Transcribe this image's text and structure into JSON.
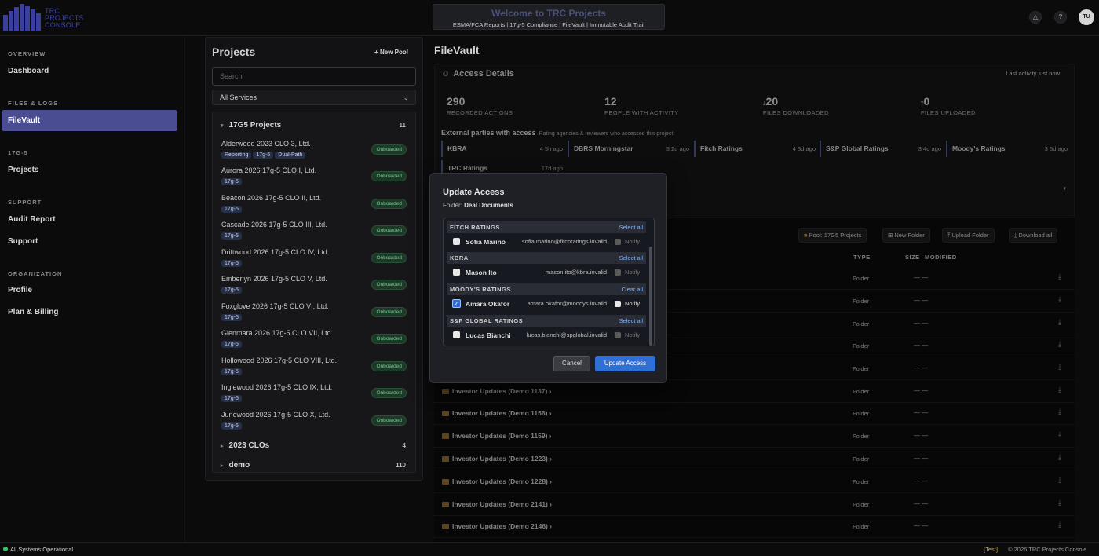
{
  "brand": {
    "line1": "TRC",
    "line2": "PROJECTS",
    "line3": "CONSOLE"
  },
  "header": {
    "welcome": "Welcome to TRC Projects",
    "subtitle": "ESMA/FCA Reports | 17g-5 Compliance | FileVault | Immutable Audit Trail",
    "avatar": "TU"
  },
  "sidebar": {
    "overview": "OVERVIEW",
    "dashboard": "Dashboard",
    "files_logs": "FILES & LOGS",
    "filevault": "FileVault",
    "section_17g5": "17G-5",
    "projects": "Projects",
    "support_sec": "SUPPORT",
    "audit": "Audit Report",
    "support": "Support",
    "org": "ORGANIZATION",
    "profile": "Profile",
    "billing": "Plan & Billing"
  },
  "projects": {
    "title": "Projects",
    "new_pool": "+ New Pool",
    "search_placeholder": "Search",
    "filter": "All Services",
    "groups": [
      {
        "name": "17G5 Projects",
        "count": "11"
      },
      {
        "name": "2023 CLOs",
        "count": "4"
      },
      {
        "name": "demo",
        "count": "110"
      }
    ],
    "items": [
      {
        "name": "Alderwood 2023 CLO 3, Ltd.",
        "tags": [
          "Reporting",
          "17g-5",
          "Dual-Path"
        ],
        "status": "Onboarded"
      },
      {
        "name": "Aurora 2026 17g-5 CLO I, Ltd.",
        "tags": [
          "17g-5"
        ],
        "status": "Onboarded"
      },
      {
        "name": "Beacon 2026 17g-5 CLO II, Ltd.",
        "tags": [
          "17g-5"
        ],
        "status": "Onboarded"
      },
      {
        "name": "Cascade 2026 17g-5 CLO III, Ltd.",
        "tags": [
          "17g-5"
        ],
        "status": "Onboarded"
      },
      {
        "name": "Driftwood 2026 17g-5 CLO IV, Ltd.",
        "tags": [
          "17g-5"
        ],
        "status": "Onboarded"
      },
      {
        "name": "Emberlyn 2026 17g-5 CLO V, Ltd.",
        "tags": [
          "17g-5"
        ],
        "status": "Onboarded"
      },
      {
        "name": "Foxglove 2026 17g-5 CLO VI, Ltd.",
        "tags": [
          "17g-5"
        ],
        "status": "Onboarded"
      },
      {
        "name": "Glenmara 2026 17g-5 CLO VII, Ltd.",
        "tags": [
          "17g-5"
        ],
        "status": "Onboarded"
      },
      {
        "name": "Hollowood 2026 17g-5 CLO VIII, Ltd.",
        "tags": [
          "17g-5"
        ],
        "status": "Onboarded"
      },
      {
        "name": "Inglewood 2026 17g-5 CLO IX, Ltd.",
        "tags": [
          "17g-5"
        ],
        "status": "Onboarded"
      },
      {
        "name": "Junewood 2026 17g-5 CLO X, Ltd.",
        "tags": [
          "17g-5"
        ],
        "status": "Onboarded"
      }
    ]
  },
  "filevault": {
    "title": "FileVault",
    "access_title": "Access Details",
    "last_activity": "Last activity just now",
    "stats": [
      {
        "value": "290",
        "label": "RECORDED ACTIONS"
      },
      {
        "value": "12",
        "label": "PEOPLE WITH ACTIVITY"
      },
      {
        "value": "20",
        "label": "FILES DOWNLOADED"
      },
      {
        "value": "0",
        "label": "FILES UPLOADED"
      }
    ],
    "ext_title": "External parties with access",
    "ext_sub": "Rating agencies & reviewers who accessed this project",
    "parties": [
      {
        "name": "KBRA",
        "meta": "4  5h ago"
      },
      {
        "name": "DBRS Morningstar",
        "meta": "3  2d ago"
      },
      {
        "name": "Fitch Ratings",
        "meta": "4  3d ago"
      },
      {
        "name": "S&P Global Ratings",
        "meta": "3  4d ago"
      },
      {
        "name": "Moody's Ratings",
        "meta": "3  5d ago"
      },
      {
        "name": "TRC Ratings",
        "meta": "17d ago"
      }
    ],
    "toolbar": {
      "pool": "Pool: 17G5 Projects",
      "new_folder": "New Folder",
      "upload": "Upload Folder",
      "download": "Download all"
    },
    "columns": {
      "type": "TYPE",
      "size": "SIZE",
      "modified": "MODIFIED"
    },
    "rows": [
      {
        "name": "",
        "type": "Folder",
        "size": "— —"
      },
      {
        "name": "",
        "type": "Folder",
        "size": "— —"
      },
      {
        "name": "",
        "type": "Folder",
        "size": "— —"
      },
      {
        "name": "",
        "type": "Folder",
        "size": "— —"
      },
      {
        "name": "",
        "type": "Folder",
        "size": "— —"
      },
      {
        "name": "Investor Updates (Demo 1137)",
        "type": "Folder",
        "size": "— —"
      },
      {
        "name": "Investor Updates (Demo 1156)",
        "type": "Folder",
        "size": "— —"
      },
      {
        "name": "Investor Updates (Demo 1159)",
        "type": "Folder",
        "size": "— —"
      },
      {
        "name": "Investor Updates (Demo 1223)",
        "type": "Folder",
        "size": "— —"
      },
      {
        "name": "Investor Updates (Demo 1228)",
        "type": "Folder",
        "size": "— —"
      },
      {
        "name": "Investor Updates (Demo 2141)",
        "type": "Folder",
        "size": "— —"
      },
      {
        "name": "Investor Updates (Demo 2146)",
        "type": "Folder",
        "size": "— —"
      }
    ]
  },
  "modal": {
    "title": "Update Access",
    "folder_label": "Folder:",
    "folder_name": "Deal Documents",
    "groups": [
      {
        "name": "FITCH RATINGS",
        "action": "Select all",
        "person": "Sofia Marino",
        "email": "sofia.marino@fitchratings.invalid",
        "checked": false
      },
      {
        "name": "KBRA",
        "action": "Select all",
        "person": "Mason Ito",
        "email": "mason.ito@kbra.invalid",
        "checked": false
      },
      {
        "name": "MOODY'S RATINGS",
        "action": "Clear all",
        "person": "Amara Okafor",
        "email": "amara.okafor@moodys.invalid",
        "checked": true
      },
      {
        "name": "S&P GLOBAL RATINGS",
        "action": "Select all",
        "person": "Lucas Bianchi",
        "email": "lucas.bianchi@spglobal.invalid",
        "checked": false
      }
    ],
    "notify": "Notify",
    "cancel": "Cancel",
    "update": "Update Access"
  },
  "footer": {
    "status": "All Systems Operational",
    "env": "[Test]",
    "copyright": "© 2026 TRC Projects Console"
  }
}
